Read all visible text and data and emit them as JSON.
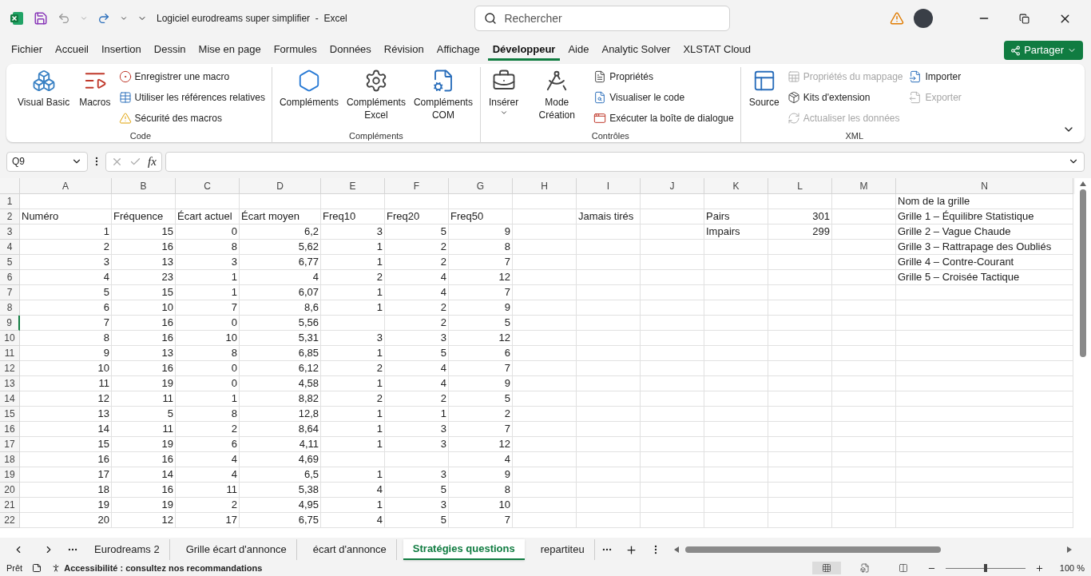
{
  "window": {
    "title": "Logiciel eurodreams super simplifier  -  Excel",
    "search": {
      "placeholder": "Rechercher"
    }
  },
  "menu_tabs": [
    {
      "label": "Fichier",
      "selected": false
    },
    {
      "label": "Accueil",
      "selected": false
    },
    {
      "label": "Insertion",
      "selected": false
    },
    {
      "label": "Dessin",
      "selected": false
    },
    {
      "label": "Mise en page",
      "selected": false
    },
    {
      "label": "Formules",
      "selected": false
    },
    {
      "label": "Données",
      "selected": false
    },
    {
      "label": "Révision",
      "selected": false
    },
    {
      "label": "Affichage",
      "selected": false
    },
    {
      "label": "Développeur",
      "selected": true
    },
    {
      "label": "Aide",
      "selected": false
    },
    {
      "label": "Analytic Solver",
      "selected": false
    },
    {
      "label": "XLSTAT Cloud",
      "selected": false
    }
  ],
  "share_button": "Partager",
  "ribbon_groups": [
    {
      "name": "Code",
      "items": [
        {
          "kind": "large",
          "label": "Visual Basic"
        },
        {
          "kind": "large",
          "label": "Macros"
        },
        {
          "kind": "small",
          "label": "Enregistrer une macro",
          "disabled": false
        },
        {
          "kind": "small",
          "label": "Utiliser les références relatives",
          "disabled": false
        },
        {
          "kind": "small",
          "label": "Sécurité des macros",
          "disabled": false
        }
      ]
    },
    {
      "name": "Compléments",
      "items": [
        {
          "kind": "large",
          "label": "Compléments"
        },
        {
          "kind": "large",
          "label": "Compléments Excel"
        },
        {
          "kind": "large",
          "label": "Compléments COM"
        }
      ]
    },
    {
      "name": "Contrôles",
      "items": [
        {
          "kind": "dropdown",
          "label": "Insérer"
        },
        {
          "kind": "large",
          "label": "Mode Création"
        },
        {
          "kind": "small",
          "label": "Propriétés",
          "disabled": false
        },
        {
          "kind": "small",
          "label": "Visualiser le code",
          "disabled": false
        },
        {
          "kind": "small",
          "label": "Exécuter la boîte de dialogue",
          "disabled": false
        }
      ]
    },
    {
      "name": "XML",
      "items": [
        {
          "kind": "large",
          "label": "Source"
        },
        {
          "kind": "small",
          "label": "Propriétés du mappage",
          "disabled": true
        },
        {
          "kind": "small",
          "label": "Kits d'extension",
          "disabled": false
        },
        {
          "kind": "small",
          "label": "Actualiser les données",
          "disabled": true
        },
        {
          "kind": "small",
          "label": "Importer",
          "disabled": false
        },
        {
          "kind": "small",
          "label": "Exporter",
          "disabled": true
        }
      ]
    }
  ],
  "formula_bar": {
    "name_box": "Q9",
    "function_label": "fx"
  },
  "columns": [
    "A",
    "B",
    "C",
    "D",
    "E",
    "F",
    "G",
    "H",
    "I",
    "J",
    "K",
    "L",
    "M",
    "N"
  ],
  "rows": [
    {
      "header": "1",
      "selected": false,
      "cells": {
        "N": {
          "kind": "text",
          "text": "Nom de la grille"
        }
      }
    },
    {
      "header": "2",
      "selected": false,
      "cells": {
        "A": {
          "kind": "text",
          "text": "Numéro"
        },
        "B": {
          "kind": "text",
          "text": "Fréquence"
        },
        "C": {
          "kind": "text",
          "text": "Écart actuel"
        },
        "D": {
          "kind": "text",
          "text": "Écart moyen"
        },
        "E": {
          "kind": "text",
          "text": "Freq10"
        },
        "F": {
          "kind": "text",
          "text": "Freq20"
        },
        "G": {
          "kind": "text",
          "text": "Freq50"
        },
        "I": {
          "kind": "text",
          "text": "Jamais tirés"
        },
        "K": {
          "kind": "text",
          "text": "Pairs"
        },
        "L": {
          "kind": "number",
          "text": "301"
        },
        "N": {
          "kind": "text",
          "text": "Grille 1 – Équilibre Statistique"
        }
      }
    },
    {
      "header": "3",
      "selected": false,
      "cells": {
        "A": {
          "kind": "number",
          "text": "1"
        },
        "B": {
          "kind": "number",
          "text": "15"
        },
        "C": {
          "kind": "number",
          "text": "0"
        },
        "D": {
          "kind": "number",
          "text": "6,2"
        },
        "E": {
          "kind": "number",
          "text": "3"
        },
        "F": {
          "kind": "number",
          "text": "5"
        },
        "G": {
          "kind": "number",
          "text": "9"
        },
        "K": {
          "kind": "text",
          "text": "Impairs"
        },
        "L": {
          "kind": "number",
          "text": "299"
        },
        "N": {
          "kind": "text",
          "text": "Grille 2 – Vague Chaude"
        }
      }
    },
    {
      "header": "4",
      "selected": false,
      "cells": {
        "A": {
          "kind": "number",
          "text": "2"
        },
        "B": {
          "kind": "number",
          "text": "16"
        },
        "C": {
          "kind": "number",
          "text": "8"
        },
        "D": {
          "kind": "number",
          "text": "5,62"
        },
        "E": {
          "kind": "number",
          "text": "1"
        },
        "F": {
          "kind": "number",
          "text": "2"
        },
        "G": {
          "kind": "number",
          "text": "8"
        },
        "N": {
          "kind": "text",
          "text": "Grille 3 – Rattrapage des Oubliés"
        }
      }
    },
    {
      "header": "5",
      "selected": false,
      "cells": {
        "A": {
          "kind": "number",
          "text": "3"
        },
        "B": {
          "kind": "number",
          "text": "13"
        },
        "C": {
          "kind": "number",
          "text": "3"
        },
        "D": {
          "kind": "number",
          "text": "6,77"
        },
        "E": {
          "kind": "number",
          "text": "1"
        },
        "F": {
          "kind": "number",
          "text": "2"
        },
        "G": {
          "kind": "number",
          "text": "7"
        },
        "N": {
          "kind": "text",
          "text": "Grille 4 – Contre-Courant"
        }
      }
    },
    {
      "header": "6",
      "selected": false,
      "cells": {
        "A": {
          "kind": "number",
          "text": "4"
        },
        "B": {
          "kind": "number",
          "text": "23"
        },
        "C": {
          "kind": "number",
          "text": "1"
        },
        "D": {
          "kind": "number",
          "text": "4"
        },
        "E": {
          "kind": "number",
          "text": "2"
        },
        "F": {
          "kind": "number",
          "text": "4"
        },
        "G": {
          "kind": "number",
          "text": "12"
        },
        "N": {
          "kind": "text",
          "text": "Grille 5 – Croisée Tactique"
        }
      }
    },
    {
      "header": "7",
      "selected": false,
      "cells": {
        "A": {
          "kind": "number",
          "text": "5"
        },
        "B": {
          "kind": "number",
          "text": "15"
        },
        "C": {
          "kind": "number",
          "text": "1"
        },
        "D": {
          "kind": "number",
          "text": "6,07"
        },
        "E": {
          "kind": "number",
          "text": "1"
        },
        "F": {
          "kind": "number",
          "text": "4"
        },
        "G": {
          "kind": "number",
          "text": "7"
        }
      }
    },
    {
      "header": "8",
      "selected": false,
      "cells": {
        "A": {
          "kind": "number",
          "text": "6"
        },
        "B": {
          "kind": "number",
          "text": "10"
        },
        "C": {
          "kind": "number",
          "text": "7"
        },
        "D": {
          "kind": "number",
          "text": "8,6"
        },
        "E": {
          "kind": "number",
          "text": "1"
        },
        "F": {
          "kind": "number",
          "text": "2"
        },
        "G": {
          "kind": "number",
          "text": "9"
        }
      }
    },
    {
      "header": "9",
      "selected": true,
      "cells": {
        "A": {
          "kind": "number",
          "text": "7"
        },
        "B": {
          "kind": "number",
          "text": "16"
        },
        "C": {
          "kind": "number",
          "text": "0"
        },
        "D": {
          "kind": "number",
          "text": "5,56"
        },
        "F": {
          "kind": "number",
          "text": "2"
        },
        "G": {
          "kind": "number",
          "text": "5"
        }
      }
    },
    {
      "header": "10",
      "selected": false,
      "cells": {
        "A": {
          "kind": "number",
          "text": "8"
        },
        "B": {
          "kind": "number",
          "text": "16"
        },
        "C": {
          "kind": "number",
          "text": "10"
        },
        "D": {
          "kind": "number",
          "text": "5,31"
        },
        "E": {
          "kind": "number",
          "text": "3"
        },
        "F": {
          "kind": "number",
          "text": "3"
        },
        "G": {
          "kind": "number",
          "text": "12"
        }
      }
    },
    {
      "header": "11",
      "selected": false,
      "cells": {
        "A": {
          "kind": "number",
          "text": "9"
        },
        "B": {
          "kind": "number",
          "text": "13"
        },
        "C": {
          "kind": "number",
          "text": "8"
        },
        "D": {
          "kind": "number",
          "text": "6,85"
        },
        "E": {
          "kind": "number",
          "text": "1"
        },
        "F": {
          "kind": "number",
          "text": "5"
        },
        "G": {
          "kind": "number",
          "text": "6"
        }
      }
    },
    {
      "header": "12",
      "selected": false,
      "cells": {
        "A": {
          "kind": "number",
          "text": "10"
        },
        "B": {
          "kind": "number",
          "text": "16"
        },
        "C": {
          "kind": "number",
          "text": "0"
        },
        "D": {
          "kind": "number",
          "text": "6,12"
        },
        "E": {
          "kind": "number",
          "text": "2"
        },
        "F": {
          "kind": "number",
          "text": "4"
        },
        "G": {
          "kind": "number",
          "text": "7"
        }
      }
    },
    {
      "header": "13",
      "selected": false,
      "cells": {
        "A": {
          "kind": "number",
          "text": "11"
        },
        "B": {
          "kind": "number",
          "text": "19"
        },
        "C": {
          "kind": "number",
          "text": "0"
        },
        "D": {
          "kind": "number",
          "text": "4,58"
        },
        "E": {
          "kind": "number",
          "text": "1"
        },
        "F": {
          "kind": "number",
          "text": "4"
        },
        "G": {
          "kind": "number",
          "text": "9"
        }
      }
    },
    {
      "header": "14",
      "selected": false,
      "cells": {
        "A": {
          "kind": "number",
          "text": "12"
        },
        "B": {
          "kind": "number",
          "text": "11"
        },
        "C": {
          "kind": "number",
          "text": "1"
        },
        "D": {
          "kind": "number",
          "text": "8,82"
        },
        "E": {
          "kind": "number",
          "text": "2"
        },
        "F": {
          "kind": "number",
          "text": "2"
        },
        "G": {
          "kind": "number",
          "text": "5"
        }
      }
    },
    {
      "header": "15",
      "selected": false,
      "cells": {
        "A": {
          "kind": "number",
          "text": "13"
        },
        "B": {
          "kind": "number",
          "text": "5"
        },
        "C": {
          "kind": "number",
          "text": "8"
        },
        "D": {
          "kind": "number",
          "text": "12,8"
        },
        "E": {
          "kind": "number",
          "text": "1"
        },
        "F": {
          "kind": "number",
          "text": "1"
        },
        "G": {
          "kind": "number",
          "text": "2"
        }
      }
    },
    {
      "header": "16",
      "selected": false,
      "cells": {
        "A": {
          "kind": "number",
          "text": "14"
        },
        "B": {
          "kind": "number",
          "text": "11"
        },
        "C": {
          "kind": "number",
          "text": "2"
        },
        "D": {
          "kind": "number",
          "text": "8,64"
        },
        "E": {
          "kind": "number",
          "text": "1"
        },
        "F": {
          "kind": "number",
          "text": "3"
        },
        "G": {
          "kind": "number",
          "text": "7"
        }
      }
    },
    {
      "header": "17",
      "selected": false,
      "cells": {
        "A": {
          "kind": "number",
          "text": "15"
        },
        "B": {
          "kind": "number",
          "text": "19"
        },
        "C": {
          "kind": "number",
          "text": "6"
        },
        "D": {
          "kind": "number",
          "text": "4,11"
        },
        "E": {
          "kind": "number",
          "text": "1"
        },
        "F": {
          "kind": "number",
          "text": "3"
        },
        "G": {
          "kind": "number",
          "text": "12"
        }
      }
    },
    {
      "header": "18",
      "selected": false,
      "cells": {
        "A": {
          "kind": "number",
          "text": "16"
        },
        "B": {
          "kind": "number",
          "text": "16"
        },
        "C": {
          "kind": "number",
          "text": "4"
        },
        "D": {
          "kind": "number",
          "text": "4,69"
        },
        "G": {
          "kind": "number",
          "text": "4"
        }
      }
    },
    {
      "header": "19",
      "selected": false,
      "cells": {
        "A": {
          "kind": "number",
          "text": "17"
        },
        "B": {
          "kind": "number",
          "text": "14"
        },
        "C": {
          "kind": "number",
          "text": "4"
        },
        "D": {
          "kind": "number",
          "text": "6,5"
        },
        "E": {
          "kind": "number",
          "text": "1"
        },
        "F": {
          "kind": "number",
          "text": "3"
        },
        "G": {
          "kind": "number",
          "text": "9"
        }
      }
    },
    {
      "header": "20",
      "selected": false,
      "cells": {
        "A": {
          "kind": "number",
          "text": "18"
        },
        "B": {
          "kind": "number",
          "text": "16"
        },
        "C": {
          "kind": "number",
          "text": "11"
        },
        "D": {
          "kind": "number",
          "text": "5,38"
        },
        "E": {
          "kind": "number",
          "text": "4"
        },
        "F": {
          "kind": "number",
          "text": "5"
        },
        "G": {
          "kind": "number",
          "text": "8"
        }
      }
    },
    {
      "header": "21",
      "selected": false,
      "cells": {
        "A": {
          "kind": "number",
          "text": "19"
        },
        "B": {
          "kind": "number",
          "text": "19"
        },
        "C": {
          "kind": "number",
          "text": "2"
        },
        "D": {
          "kind": "number",
          "text": "4,95"
        },
        "E": {
          "kind": "number",
          "text": "1"
        },
        "F": {
          "kind": "number",
          "text": "3"
        },
        "G": {
          "kind": "number",
          "text": "10"
        }
      }
    },
    {
      "header": "22",
      "selected": false,
      "cells": {
        "A": {
          "kind": "number",
          "text": "20"
        },
        "B": {
          "kind": "number",
          "text": "12"
        },
        "C": {
          "kind": "number",
          "text": "17"
        },
        "D": {
          "kind": "number",
          "text": "6,75"
        },
        "E": {
          "kind": "number",
          "text": "4"
        },
        "F": {
          "kind": "number",
          "text": "5"
        },
        "G": {
          "kind": "number",
          "text": "7"
        }
      }
    }
  ],
  "sheet_tabs": [
    {
      "label": "Eurodreams 2",
      "selected": false
    },
    {
      "label": "Grille écart d'annonce",
      "selected": false
    },
    {
      "label": "écart d'annonce",
      "selected": false
    },
    {
      "label": "Stratégies questions",
      "selected": true
    },
    {
      "label": "repartiteu",
      "selected": false
    }
  ],
  "status_bar": {
    "mode": "Prêt",
    "accessibility": "Accessibilité : consultez nos recommandations",
    "zoom": {
      "level": 0.5,
      "reading": "100 %"
    },
    "views": [
      {
        "selected": true
      },
      {
        "selected": false
      },
      {
        "selected": false
      }
    ]
  }
}
